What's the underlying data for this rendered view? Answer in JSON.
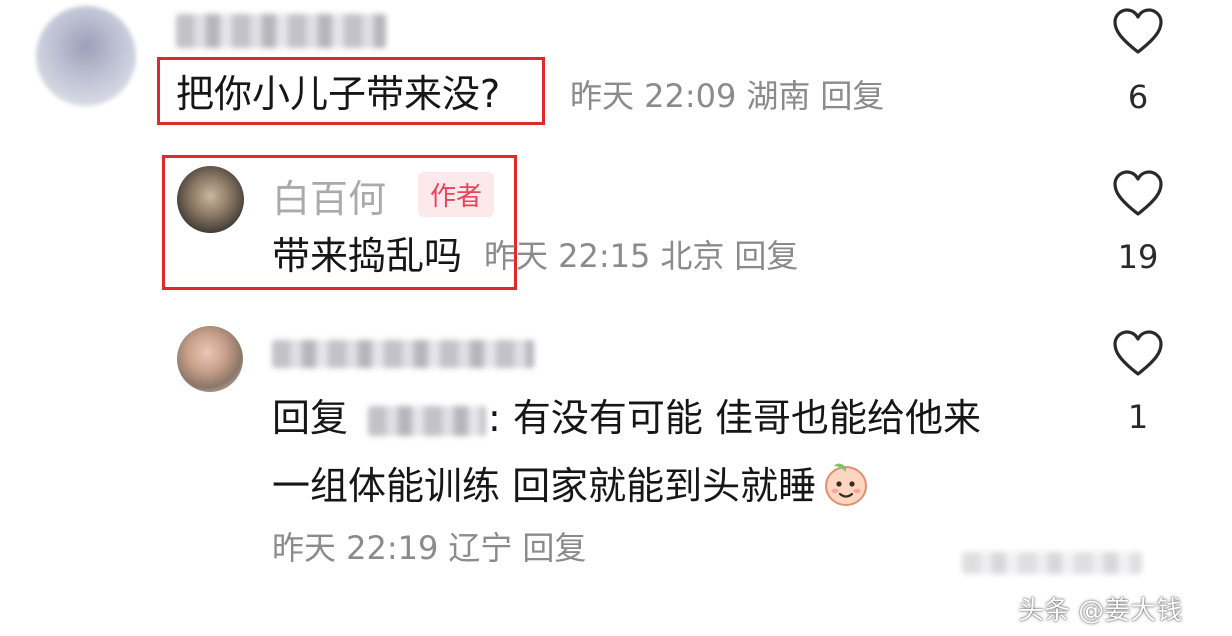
{
  "comments": [
    {
      "text": "把你小儿子带来没?",
      "time": "昨天 22:09",
      "location": "湖南",
      "reply_label": "回复",
      "like_count": "6"
    },
    {
      "author_name": "白百何",
      "author_badge": "作者",
      "text": "带来捣乱吗",
      "time": "昨天 22:15",
      "location": "北京",
      "reply_label": "回复",
      "like_count": "19"
    },
    {
      "reply_prefix": "回复",
      "text_line1": ": 有没有可能 佳哥也能给他来",
      "text_line2": "一组体能训练 回家就能到头就睡",
      "time": "昨天 22:19",
      "location": "辽宁",
      "reply_label": "回复",
      "like_count": "1"
    }
  ],
  "watermark": "头条 @姜大钱",
  "icons": {
    "like": "heart-outline-icon",
    "emoji": "peach-emoji-icon"
  },
  "colors": {
    "highlight_box": "#e02a2a",
    "author_badge": "#e8445a",
    "meta_text": "#8a8a8f"
  }
}
